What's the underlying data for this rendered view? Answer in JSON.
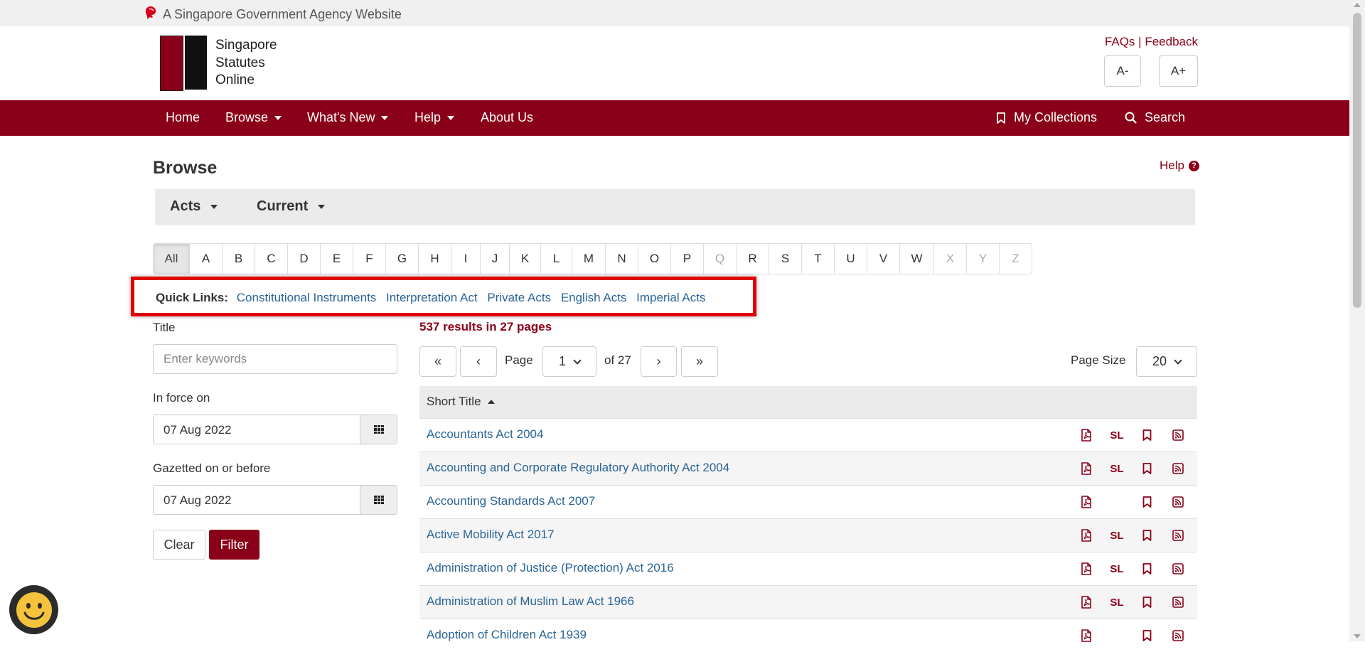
{
  "gov_bar": {
    "text": "A Singapore Government Agency Website"
  },
  "logo": {
    "line1": "Singapore",
    "line2": "Statutes",
    "line3": "Online"
  },
  "header": {
    "faqs": "FAQs",
    "separator": "|",
    "feedback": "Feedback",
    "font_decrease": "A-",
    "font_increase": "A+"
  },
  "nav": {
    "home": "Home",
    "browse": "Browse",
    "whats_new": "What's New",
    "help": "Help",
    "about": "About Us",
    "collections": "My Collections",
    "search": "Search"
  },
  "page": {
    "title": "Browse",
    "help": "Help"
  },
  "filter_bar": {
    "type": "Acts",
    "status": "Current"
  },
  "alphabet": [
    {
      "label": "All",
      "state": "active"
    },
    {
      "label": "A"
    },
    {
      "label": "B"
    },
    {
      "label": "C"
    },
    {
      "label": "D"
    },
    {
      "label": "E"
    },
    {
      "label": "F"
    },
    {
      "label": "G"
    },
    {
      "label": "H"
    },
    {
      "label": "I"
    },
    {
      "label": "J"
    },
    {
      "label": "K"
    },
    {
      "label": "L"
    },
    {
      "label": "M"
    },
    {
      "label": "N"
    },
    {
      "label": "O"
    },
    {
      "label": "P"
    },
    {
      "label": "Q",
      "state": "disabled"
    },
    {
      "label": "R"
    },
    {
      "label": "S"
    },
    {
      "label": "T"
    },
    {
      "label": "U"
    },
    {
      "label": "V"
    },
    {
      "label": "W"
    },
    {
      "label": "X",
      "state": "disabled"
    },
    {
      "label": "Y",
      "state": "disabled"
    },
    {
      "label": "Z",
      "state": "disabled"
    }
  ],
  "quick_links": {
    "label": "Quick Links:",
    "links": [
      "Constitutional Instruments",
      "Interpretation Act",
      "Private Acts",
      "English Acts",
      "Imperial Acts"
    ]
  },
  "filters": {
    "title_label": "Title",
    "title_placeholder": "Enter keywords",
    "in_force_label": "In force on",
    "in_force_value": "07 Aug 2022",
    "gazetted_label": "Gazetted on or before",
    "gazetted_value": "07 Aug 2022",
    "clear": "Clear",
    "filter": "Filter"
  },
  "results": {
    "summary": "537 results in 27 pages",
    "first": "«",
    "prev": "‹",
    "page_label": "Page",
    "current_page": "1",
    "of_pages": "of 27",
    "next": "›",
    "last": "»",
    "page_size_label": "Page Size",
    "page_size": "20"
  },
  "table": {
    "column_header": "Short Title",
    "sort": "ascending",
    "rows": [
      {
        "title": "Accountants Act 2004",
        "has_sl": true,
        "sl": "SL"
      },
      {
        "title": "Accounting and Corporate Regulatory Authority Act 2004",
        "has_sl": true,
        "sl": "SL"
      },
      {
        "title": "Accounting Standards Act 2007",
        "has_sl": false,
        "sl": ""
      },
      {
        "title": "Active Mobility Act 2017",
        "has_sl": true,
        "sl": "SL"
      },
      {
        "title": "Administration of Justice (Protection) Act 2016",
        "has_sl": true,
        "sl": "SL"
      },
      {
        "title": "Administration of Muslim Law Act 1966",
        "has_sl": true,
        "sl": "SL"
      },
      {
        "title": "Adoption of Children Act 1939",
        "has_sl": false,
        "sl": ""
      }
    ]
  },
  "colors": {
    "brand": "#8a0018",
    "link": "#2a6496",
    "highlight": "#e00000"
  },
  "icons": [
    "lion-head-icon",
    "bookmark-icon",
    "search-icon",
    "help-icon",
    "calendar-grid-icon",
    "pdf-icon",
    "subsidiary-legislation-icon",
    "rss-icon",
    "chat-bot-icon"
  ]
}
